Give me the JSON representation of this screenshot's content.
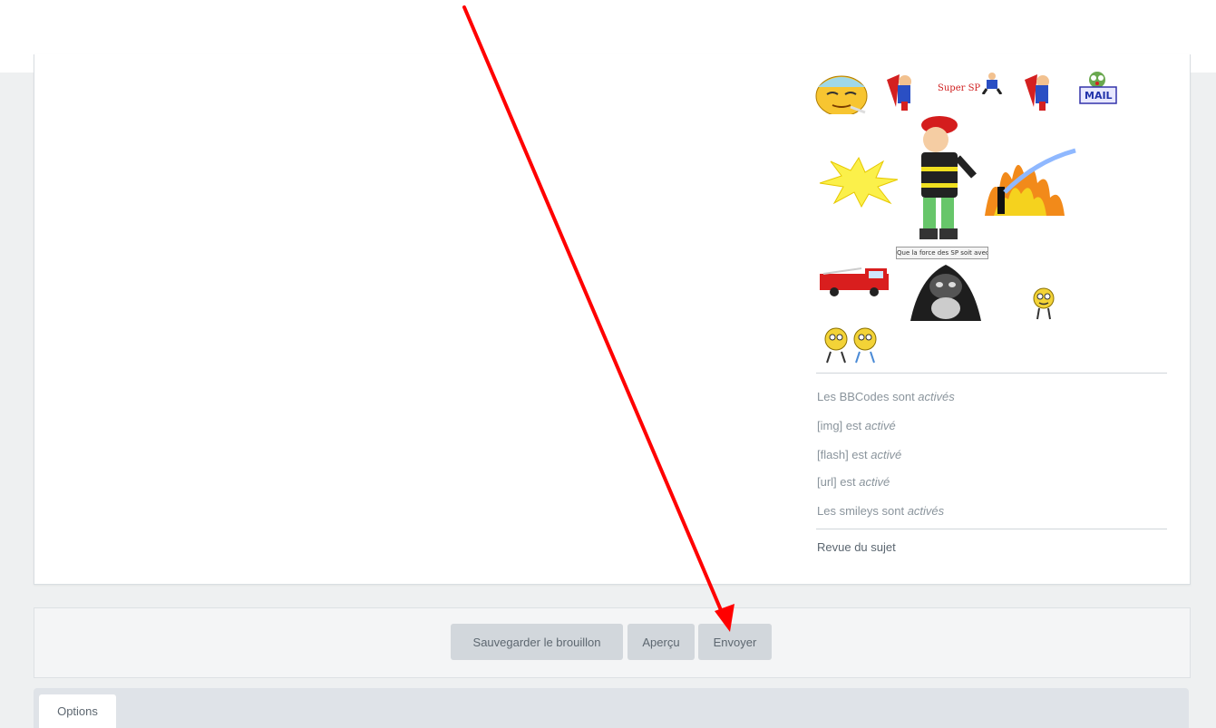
{
  "smileys": {
    "super_sp_caption": "Super SP",
    "mail_label": "MAIL",
    "speech_bubble": "Que la force des SP soit avec toi"
  },
  "status": {
    "bbcode_prefix": "Les BBCodes sont ",
    "bbcode_state": "activés",
    "img_prefix": "[img] est ",
    "img_state": "activé",
    "flash_prefix": "[flash] est ",
    "flash_state": "activé",
    "url_prefix": "[url] est ",
    "url_state": "activé",
    "smileys_prefix": "Les smileys sont ",
    "smileys_state": "activés"
  },
  "review_label": "Revue du sujet",
  "buttons": {
    "save_draft": "Sauvegarder le brouillon",
    "preview": "Aperçu",
    "send": "Envoyer"
  },
  "tabs": {
    "options": "Options"
  },
  "colors": {
    "annotation_arrow": "#ff0000"
  }
}
